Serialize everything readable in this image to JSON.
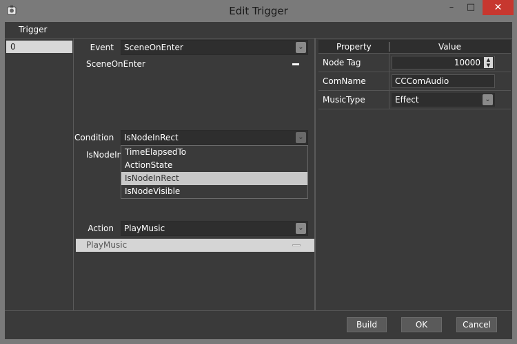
{
  "window": {
    "title": "Edit Trigger",
    "minimize_glyph": "–",
    "maximize_glyph": "□",
    "close_glyph": "✕",
    "app_icon": "app-gear-icon"
  },
  "menu": {
    "items": [
      "Trigger"
    ]
  },
  "triggers": {
    "items": [
      "0"
    ]
  },
  "event": {
    "label": "Event",
    "selected": "SceneOnEnter",
    "list": [
      "SceneOnEnter"
    ]
  },
  "condition": {
    "label": "Condition",
    "selected": "IsNodeInRect",
    "list_partial": "IsNodeIn",
    "dropdown_options": [
      "TimeElapsedTo",
      "ActionState",
      "IsNodeInRect",
      "IsNodeVisible"
    ],
    "highlighted_option": "IsNodeInRect"
  },
  "action": {
    "label": "Action",
    "selected": "PlayMusic",
    "list": [
      "PlayMusic"
    ]
  },
  "properties": {
    "header": {
      "property": "Property",
      "value": "Value"
    },
    "rows": [
      {
        "name": "Node Tag",
        "value": "10000"
      },
      {
        "name": "ComName",
        "value": "CCComAudio"
      },
      {
        "name": "MusicType",
        "value": "Effect"
      }
    ]
  },
  "buttons": {
    "build": "Build",
    "ok": "OK",
    "cancel": "Cancel"
  },
  "colors": {
    "close_button": "#c7372f",
    "background": "#3a3a3a",
    "titlebar": "#7a7a7a"
  }
}
